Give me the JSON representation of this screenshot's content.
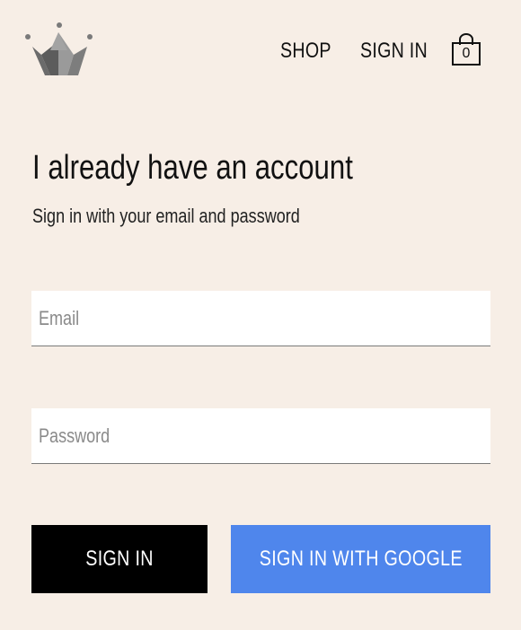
{
  "header": {
    "logo_icon": "crown-icon",
    "nav": {
      "shop_label": "SHOP",
      "signin_label": "SIGN IN"
    },
    "cart": {
      "icon": "shopping-bag-icon",
      "count": "0"
    }
  },
  "signin_form": {
    "title": "I already have an account",
    "subtitle": "Sign in with your email and password",
    "email": {
      "placeholder": "Email",
      "value": ""
    },
    "password": {
      "placeholder": "Password",
      "value": ""
    },
    "signin_button_label": "SIGN IN",
    "google_button_label": "SIGN IN WITH GOOGLE"
  },
  "colors": {
    "page_background": "#f7eee6",
    "primary_button": "#000000",
    "google_button": "#4f86ec",
    "crown_light": "#8e8e8e",
    "crown_dark": "#5e5e5e"
  }
}
